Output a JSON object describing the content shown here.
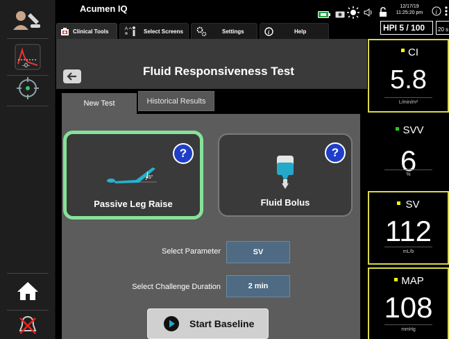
{
  "app": {
    "name": "Acumen IQ"
  },
  "status": {
    "date": "12/17/19",
    "time": "11:25:20 pm",
    "hpi_label": "HPI 5 / 100",
    "hpi_small": "20 s"
  },
  "tabs": [
    {
      "label": "Clinical Tools"
    },
    {
      "label": "Select Screens"
    },
    {
      "label": "Settings"
    },
    {
      "label": "Help"
    }
  ],
  "screen": {
    "title": "Fluid Responsiveness Test"
  },
  "subtabs": [
    {
      "label": "New Test"
    },
    {
      "label": "Historical Results"
    }
  ],
  "options": [
    {
      "label": "Passive Leg Raise",
      "angle": "45°",
      "help": "?"
    },
    {
      "label": "Fluid Bolus",
      "help": "?"
    }
  ],
  "params": {
    "parameter_label": "Select Parameter",
    "parameter_value": "SV",
    "duration_label": "Select Challenge Duration",
    "duration_value": "2 min"
  },
  "start": {
    "label": "Start Baseline"
  },
  "tiles": [
    {
      "name": "CI",
      "value": "5.8",
      "unit": "L/min/m²",
      "marker": "#ffff00"
    },
    {
      "name": "SVV",
      "value": "6",
      "unit": "%",
      "marker": "#22cc22"
    },
    {
      "name": "SV",
      "value": "112",
      "unit": "mL/b",
      "marker": "#ffff00"
    },
    {
      "name": "MAP",
      "value": "108",
      "unit": "mmHg",
      "marker": "#ffff00"
    }
  ],
  "colors": {
    "selected_border": "#86e29a",
    "tile_border": "#d9d94a",
    "help_bg": "#1f3fc8"
  }
}
